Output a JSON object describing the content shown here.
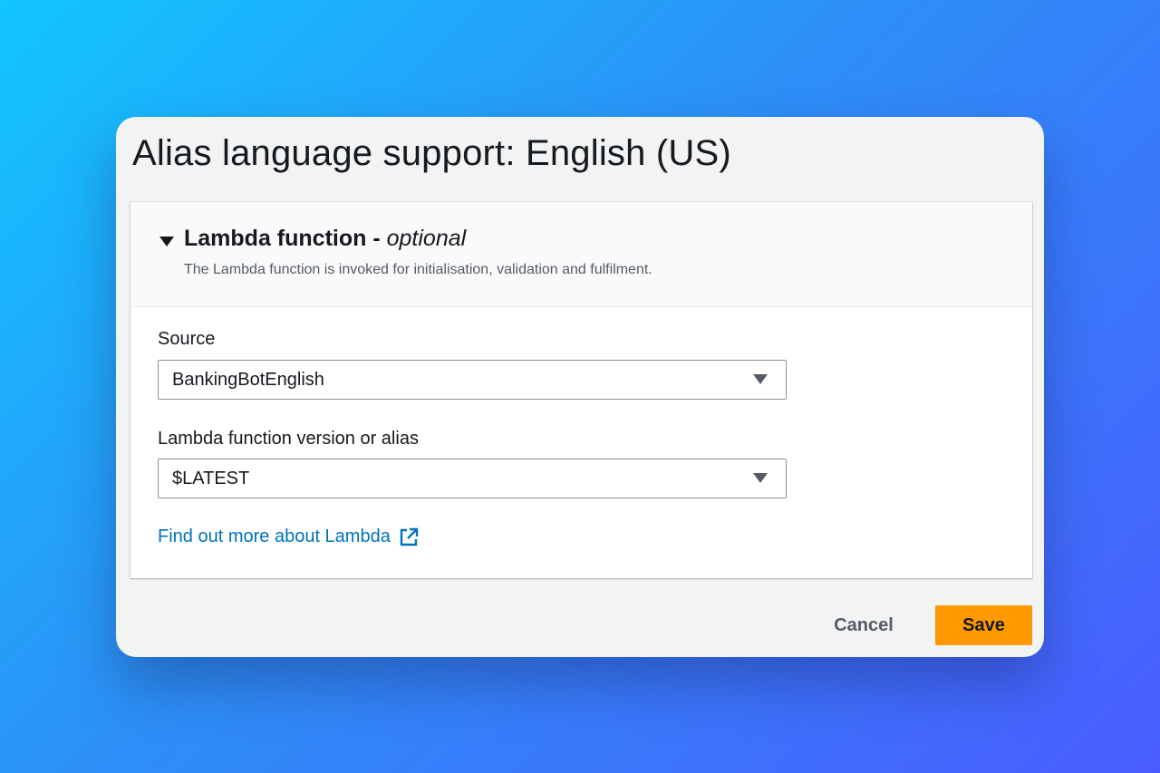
{
  "dialog": {
    "title": "Alias language support: English (US)"
  },
  "lambda_section": {
    "heading": "Lambda function",
    "heading_separator": " - ",
    "heading_optional": "optional",
    "description": "The Lambda function is invoked for initialisation, validation and fulfilment.",
    "source": {
      "label": "Source",
      "selected": "BankingBotEnglish"
    },
    "version": {
      "label": "Lambda function version or alias",
      "selected": "$LATEST"
    },
    "learn_more_link": "Find out more about Lambda"
  },
  "footer": {
    "cancel_label": "Cancel",
    "save_label": "Save"
  },
  "colors": {
    "primary_button": "#ff9900",
    "link": "#0073bb",
    "background_gradient_start": "#12c6ff",
    "background_gradient_end": "#4a5cff"
  },
  "icons": {
    "section_toggle": "caret-down-icon",
    "select_dropdown": "caret-down-icon",
    "external_link": "external-link-icon"
  }
}
